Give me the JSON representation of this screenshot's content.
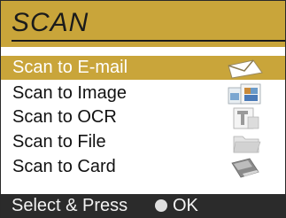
{
  "header": {
    "title": "SCAN"
  },
  "menu": {
    "selected_index": 0,
    "items": [
      {
        "label": "Scan to E-mail",
        "icon": "envelope-icon"
      },
      {
        "label": "Scan to Image",
        "icon": "image-document-icon"
      },
      {
        "label": "Scan to OCR",
        "icon": "text-document-icon"
      },
      {
        "label": "Scan to File",
        "icon": "folder-icon"
      },
      {
        "label": "Scan to Card",
        "icon": "memory-card-icon"
      }
    ]
  },
  "footer": {
    "instruction": "Select & Press",
    "ok_label": "OK"
  },
  "colors": {
    "accent": "#c9a53a",
    "status_bar": "#2b2b2b",
    "text": "#111111"
  }
}
